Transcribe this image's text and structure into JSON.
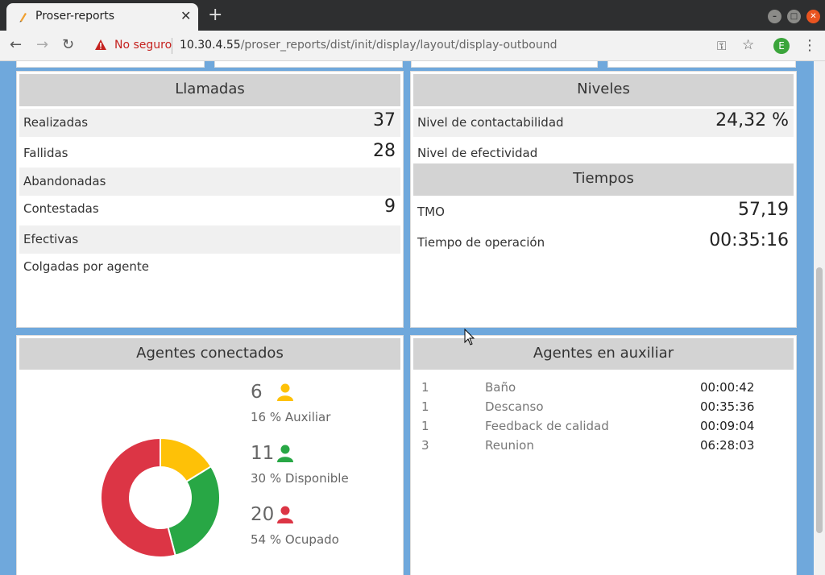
{
  "browser": {
    "tab_title": "Proser-reports",
    "not_secure": "No seguro",
    "url_host": "10.30.4.55",
    "url_path": "/proser_reports/dist/init/display/layout/display-outbound",
    "avatar_letter": "E"
  },
  "llamadas": {
    "title": "Llamadas",
    "rows": [
      {
        "label": "Realizadas",
        "value": "37"
      },
      {
        "label": "Fallidas",
        "value": "28"
      },
      {
        "label": "Abandonadas",
        "value": ""
      },
      {
        "label": "Contestadas",
        "value": "9"
      },
      {
        "label": "Efectivas",
        "value": ""
      },
      {
        "label": "Colgadas por agente",
        "value": ""
      }
    ]
  },
  "niveles": {
    "title": "Niveles",
    "rows": [
      {
        "label": "Nivel de contactabilidad",
        "value": "24,32 %"
      },
      {
        "label": "Nivel de efectividad",
        "value": ""
      }
    ]
  },
  "tiempos": {
    "title": "Tiempos",
    "rows": [
      {
        "label": "TMO",
        "value": "57,19"
      },
      {
        "label": "Tiempo de operación",
        "value": "00:35:16"
      }
    ]
  },
  "agentes": {
    "title": "Agentes conectados",
    "stats": [
      {
        "count": "6",
        "pct": "16 % Auxiliar",
        "color": "#fec107"
      },
      {
        "count": "11",
        "pct": "30 % Disponible",
        "color": "#28a745"
      },
      {
        "count": "20",
        "pct": "54 % Ocupado",
        "color": "#dc3545"
      }
    ]
  },
  "auxiliar": {
    "title": "Agentes en auxiliar",
    "rows": [
      {
        "count": "1",
        "name": "Baño",
        "time": "00:00:42"
      },
      {
        "count": "1",
        "name": "Descanso",
        "time": "00:35:36"
      },
      {
        "count": "1",
        "name": "Feedback de calidad",
        "time": "00:09:04"
      },
      {
        "count": "3",
        "name": "Reunion",
        "time": "06:28:03"
      }
    ]
  },
  "chart_data": {
    "type": "pie",
    "categories": [
      "Auxiliar",
      "Disponible",
      "Ocupado"
    ],
    "values": [
      6,
      11,
      20
    ],
    "colors": [
      "#fec107",
      "#28a745",
      "#dc3545"
    ],
    "donut": true
  }
}
